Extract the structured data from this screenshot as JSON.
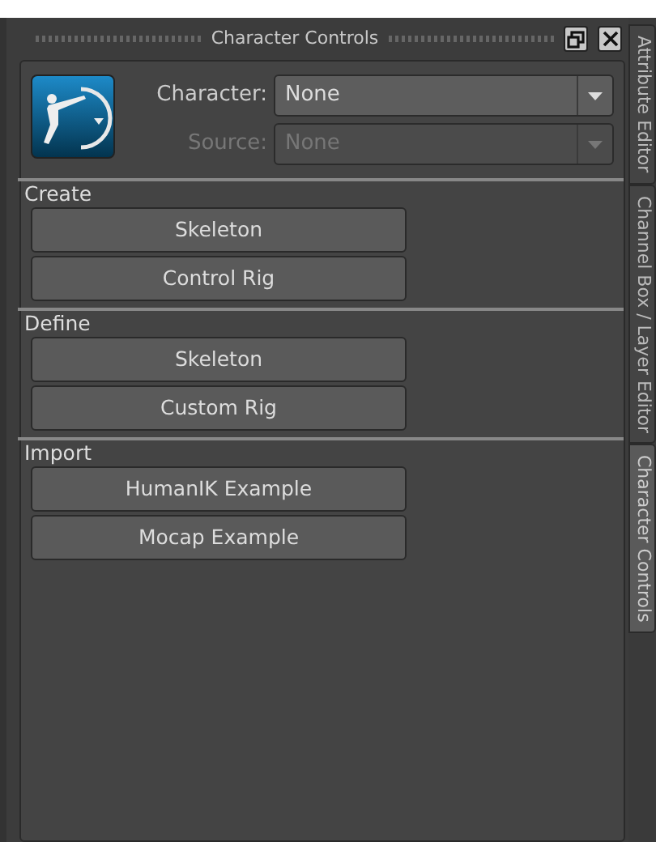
{
  "window": {
    "title": "Character Controls"
  },
  "fields": [
    {
      "label": "Character:",
      "value": "None",
      "disabled": false
    },
    {
      "label": "Source:",
      "value": "None",
      "disabled": true
    }
  ],
  "sections": [
    {
      "title": "Create",
      "buttons": [
        "Skeleton",
        "Control Rig"
      ]
    },
    {
      "title": "Define",
      "buttons": [
        "Skeleton",
        "Custom Rig"
      ]
    },
    {
      "title": "Import",
      "buttons": [
        "HumanIK Example",
        "Mocap Example"
      ]
    }
  ],
  "side_tabs": [
    {
      "label": "Attribute Editor",
      "selected": false
    },
    {
      "label": "Channel Box / Layer Editor",
      "selected": false
    },
    {
      "label": "Character Controls",
      "selected": true
    }
  ]
}
